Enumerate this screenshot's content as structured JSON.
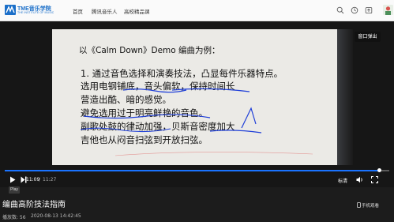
{
  "site": {
    "logo_text": "TME音乐学院",
    "logo_sub": "THE INSTITUTE OF MUSIC",
    "brand_color": "#1b6fc9"
  },
  "nav": {
    "items": [
      {
        "label": "首页"
      },
      {
        "label": "腾讯音乐人"
      },
      {
        "label": "高校精品课"
      }
    ]
  },
  "header_icons": [
    "search-icon",
    "clock-icon",
    "upload-icon",
    "avatar"
  ],
  "slide": {
    "heading": "以《Calm Down》Demo 编曲为例：",
    "lines": [
      "1. 通过音色选择和演奏技法，凸显每件乐器特点。",
      "选用电钢铺底，音头偏软，保持时间长",
      "营造出酷、暗的感觉。",
      "避免选用过于明亮鲜艳的音色。",
      "副歌处鼓的律动加强，贝斯音密度加大",
      "吉他也从闷音扫弦到开放扫弦。"
    ]
  },
  "player": {
    "popout_label": "窗口弹出",
    "current_time": "11:09",
    "total_time": "11:27",
    "progress": 0.974,
    "quality_label": "标清",
    "play_tooltip": "Play",
    "accent_color": "#1a73ff"
  },
  "video_info": {
    "title": "编曲高阶技法指南",
    "play_count": "播放数: 56",
    "date": "2020-08-13 14:42:45",
    "mobile_watch": "手机观看"
  }
}
